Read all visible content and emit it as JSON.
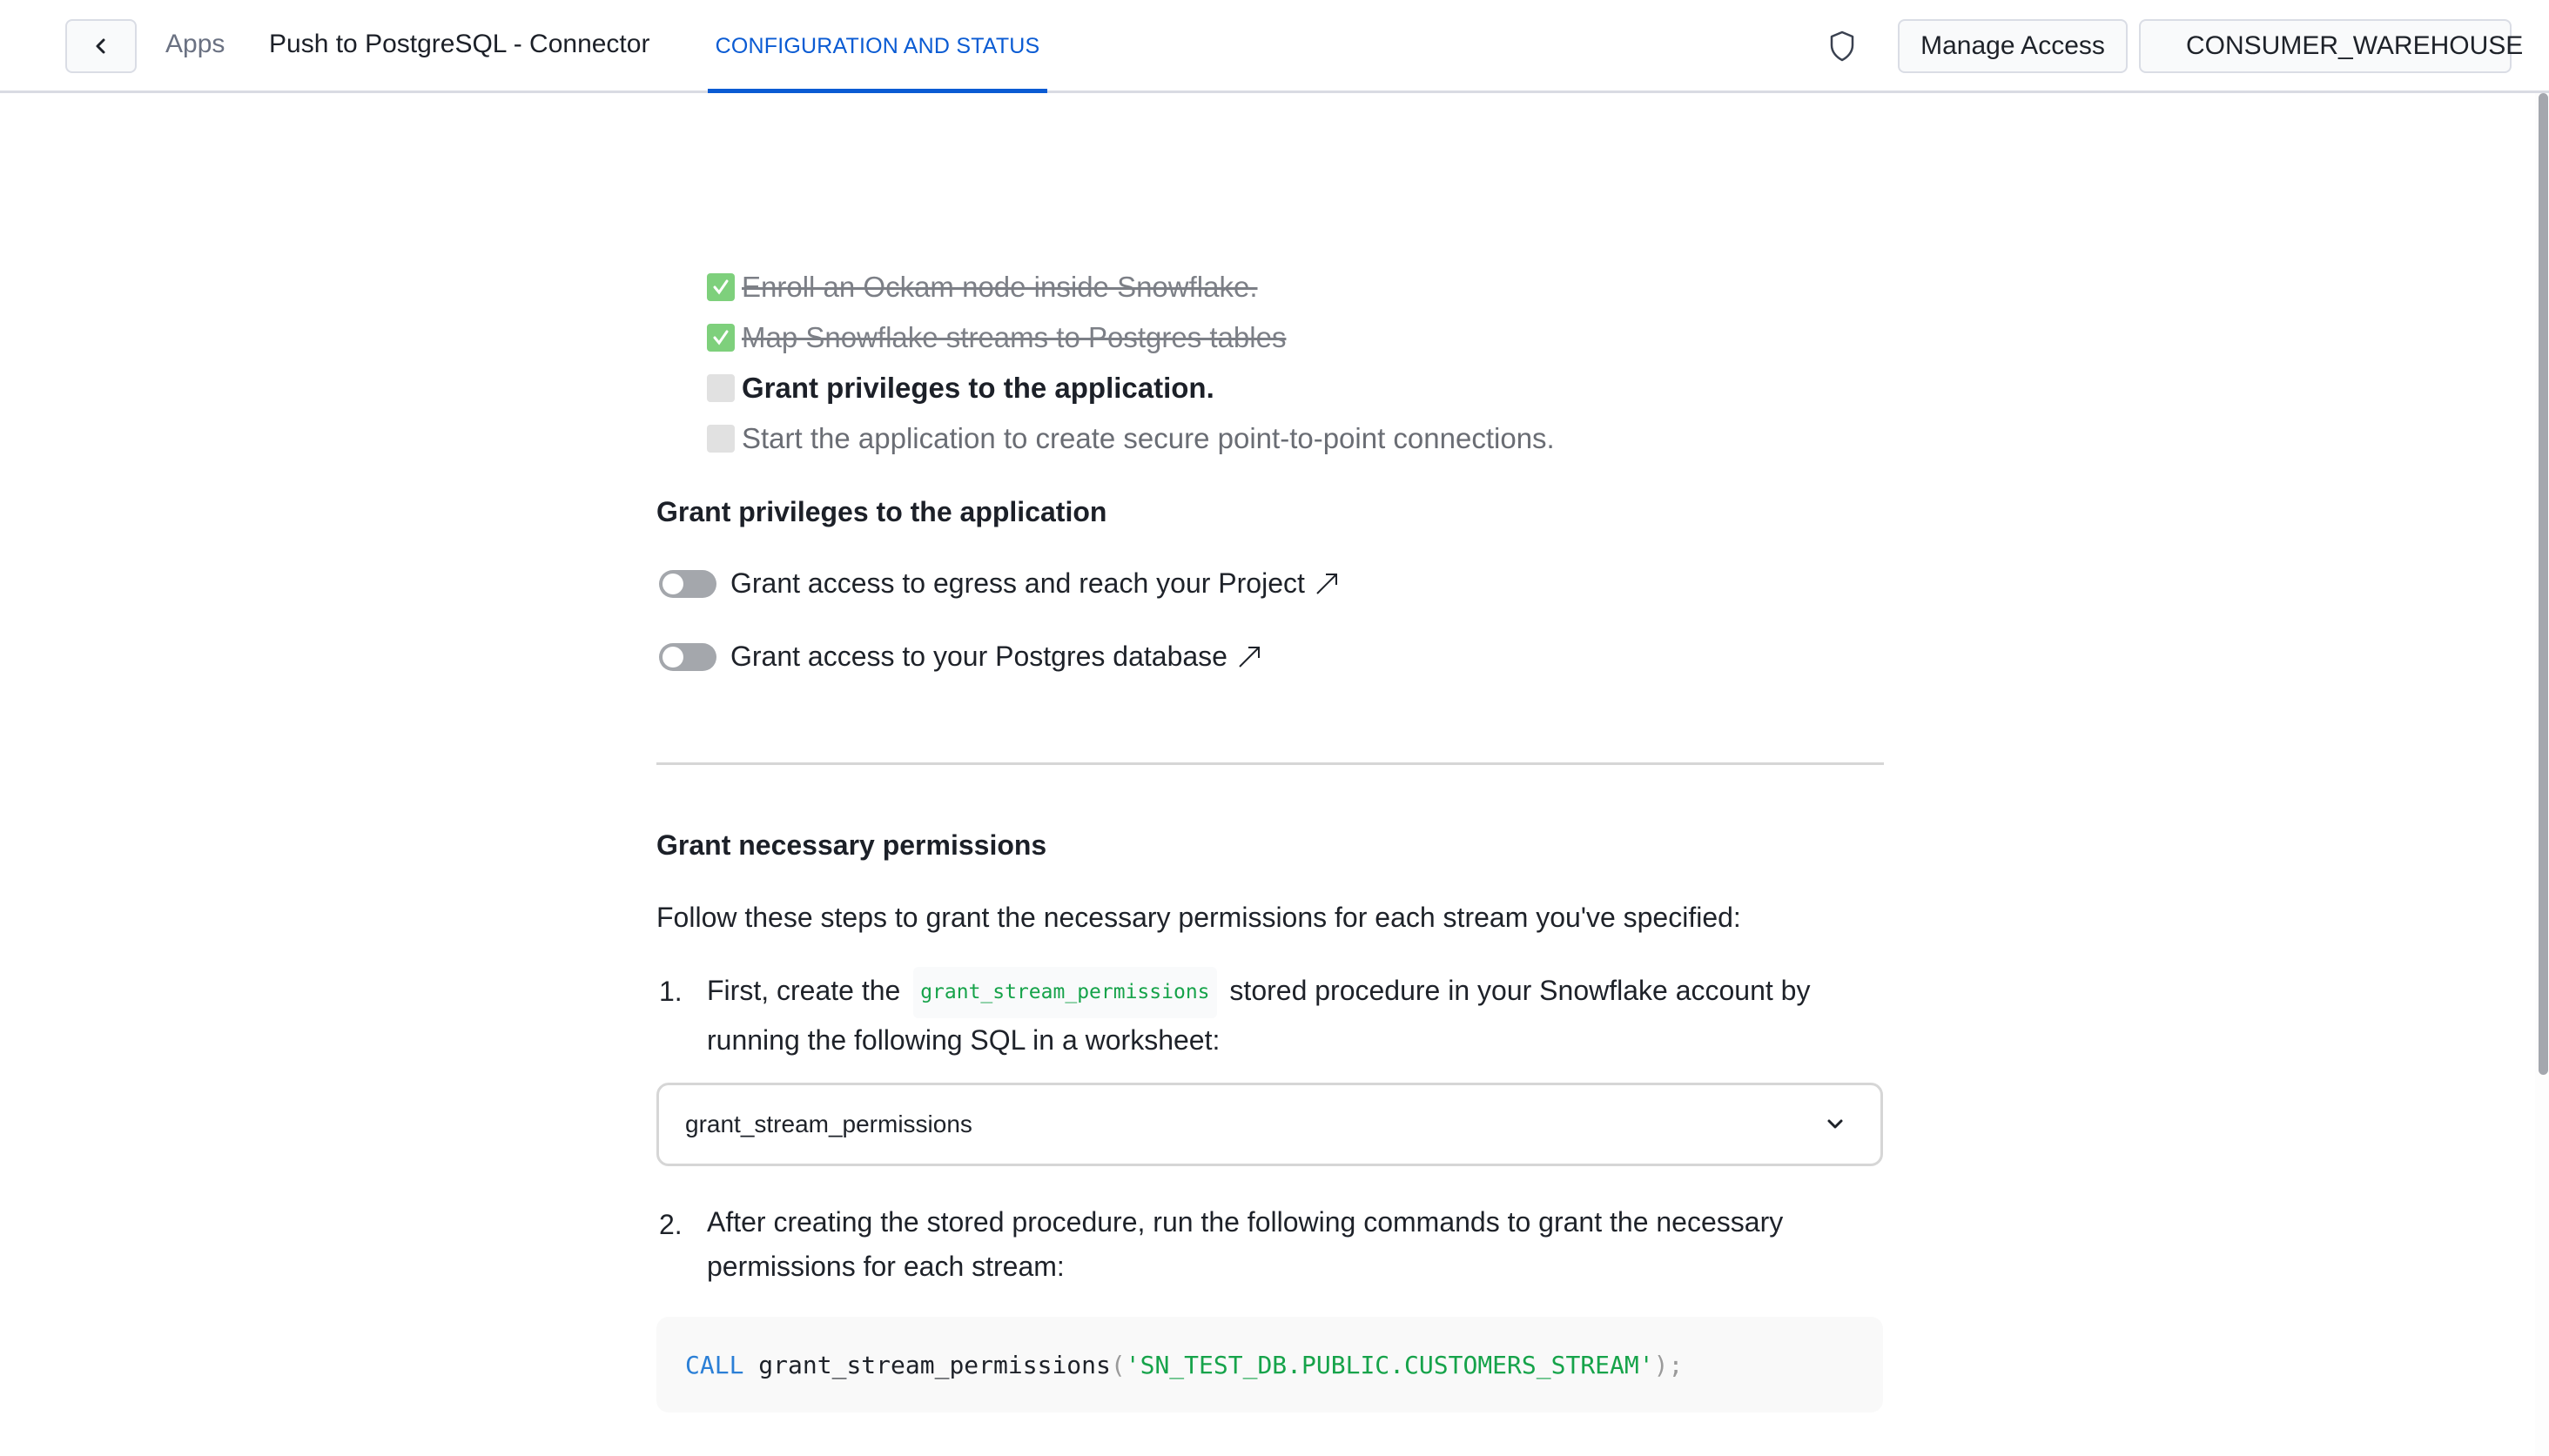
{
  "header": {
    "back_icon": "chevron-left-icon",
    "breadcrumb_apps": "Apps",
    "app_title": "Push to PostgreSQL - Connector",
    "tab_active": "CONFIGURATION AND STATUS",
    "shield_icon": "shield-icon",
    "manage_access_label": "Manage Access",
    "warehouse_label": "CONSUMER_WAREHOUSE",
    "warehouse_status_color": "#3cc38e"
  },
  "checklist": [
    {
      "label": "Enroll an Ockam node inside Snowflake.",
      "state": "done"
    },
    {
      "label": "Map Snowflake streams to Postgres tables",
      "state": "done"
    },
    {
      "label": "Grant privileges to the application.",
      "state": "active"
    },
    {
      "label": "Start the application to create secure point-to-point connections.",
      "state": "pending"
    }
  ],
  "privileges": {
    "heading": "Grant privileges to the application",
    "toggles": [
      {
        "label": "Grant access to egress and reach your Project",
        "on": false,
        "external_link_icon": "arrow-up-right-icon"
      },
      {
        "label": "Grant access to your Postgres database",
        "on": false,
        "external_link_icon": "arrow-up-right-icon"
      }
    ]
  },
  "permissions": {
    "heading": "Grant necessary permissions",
    "intro": "Follow these steps to grant the necessary permissions for each stream you've specified:",
    "steps": [
      {
        "number": "1.",
        "text_before": "First, create the",
        "code": "grant_stream_permissions",
        "text_after": "stored procedure in your Snowflake account by running the following SQL in a worksheet:"
      },
      {
        "number": "2.",
        "text": "After creating the stored procedure, run the following commands to grant the necessary permissions for each stream:"
      }
    ],
    "select_value": "grant_stream_permissions",
    "code_line": {
      "keyword": "CALL",
      "function": "grant_stream_permissions",
      "open_paren": "(",
      "argument": "'SN_TEST_DB.PUBLIC.CUSTOMERS_STREAM'",
      "close": ");"
    }
  }
}
